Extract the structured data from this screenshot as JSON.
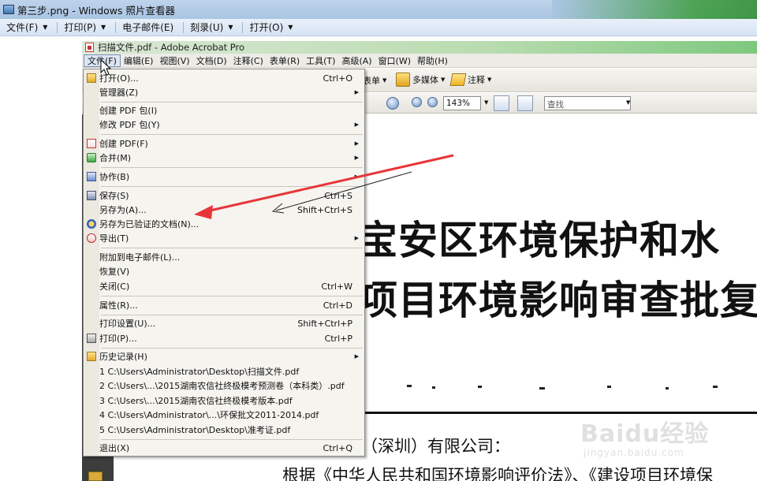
{
  "viewer": {
    "title": "第三步.png - Windows 照片查看器",
    "menu": [
      {
        "label": "文件(F)"
      },
      {
        "label": "打印(P)"
      },
      {
        "label": "电子邮件(E)"
      },
      {
        "label": "刻录(U)"
      },
      {
        "label": "打开(O)"
      }
    ]
  },
  "acrobat": {
    "title": "扫描文件.pdf - Adobe Acrobat Pro",
    "menu": [
      "文件(F)",
      "编辑(E)",
      "视图(V)",
      "文档(D)",
      "注释(C)",
      "表单(R)",
      "工具(T)",
      "高级(A)",
      "窗口(W)",
      "帮助(H)"
    ],
    "toolbar": {
      "forms": "表单",
      "multimedia": "多媒体",
      "comment": "注释",
      "zoom": "143%",
      "find_placeholder": "查找"
    }
  },
  "file_menu": {
    "items": [
      {
        "label": "打开(O)...",
        "shortcut": "Ctrl+O"
      },
      {
        "label": "管理器(Z)"
      },
      {
        "label": "创建 PDF 包(I)"
      },
      {
        "label": "修改 PDF 包(Y)"
      },
      {
        "label": "创建 PDF(F)"
      },
      {
        "label": "合并(M)"
      },
      {
        "label": "协作(B)"
      },
      {
        "label": "保存(S)",
        "shortcut": "Ctrl+S"
      },
      {
        "label": "另存为(A)...",
        "shortcut": "Shift+Ctrl+S"
      },
      {
        "label": "另存为已验证的文档(N)..."
      },
      {
        "label": "导出(T)"
      },
      {
        "label": "附加到电子邮件(L)..."
      },
      {
        "label": "恢复(V)"
      },
      {
        "label": "关闭(C)",
        "shortcut": "Ctrl+W"
      },
      {
        "label": "属性(R)...",
        "shortcut": "Ctrl+D"
      },
      {
        "label": "打印设置(U)...",
        "shortcut": "Shift+Ctrl+P"
      },
      {
        "label": "打印(P)...",
        "shortcut": "Ctrl+P"
      },
      {
        "label": "历史记录(H)"
      },
      {
        "label": "1 C:\\Users\\Administrator\\Desktop\\扫描文件.pdf"
      },
      {
        "label": "2 C:\\Users\\...\\2015湖南农信社终极模考预测卷（本科类）.pdf"
      },
      {
        "label": "3 C:\\Users\\...\\2015湖南农信社终极模考版本.pdf"
      },
      {
        "label": "4 C:\\Users\\Administrator\\...\\环保批文2011-2014.pdf"
      },
      {
        "label": "5 C:\\Users\\Administrator\\Desktop\\准考证.pdf"
      },
      {
        "label": "退出(X)",
        "shortcut": "Ctrl+Q"
      }
    ]
  },
  "document": {
    "line1": "宝安区环境保护和水",
    "line2": "项目环境影响审查批复",
    "line3": "（深圳）有限公司：",
    "line4": "根据《中华人民共和国环境影响评价法》、《建设项目环境保"
  },
  "watermark": {
    "top": "Baidu经验",
    "bottom": "jingyan.baidu.com"
  },
  "colors": {
    "annotation_arrow": "#e8353a",
    "menu_background": "#f5f4ef",
    "acrobat_title_accent": "#7ec87e"
  }
}
